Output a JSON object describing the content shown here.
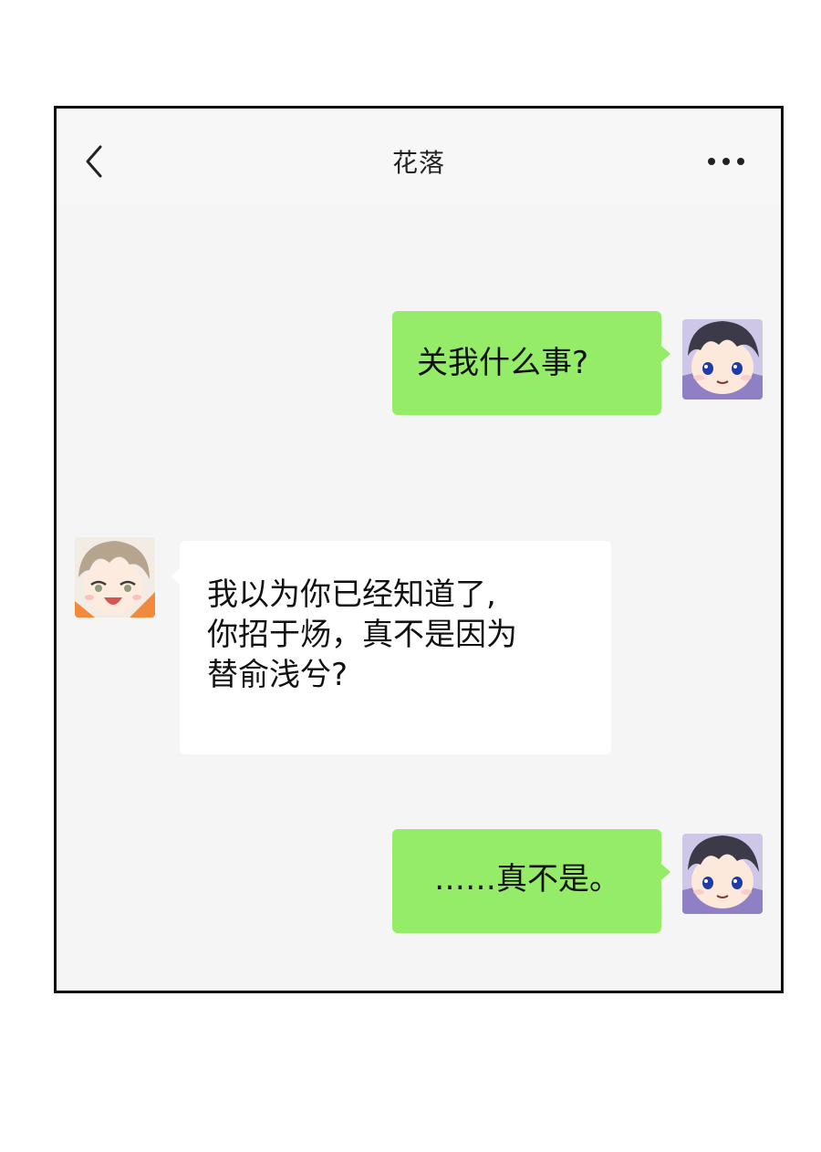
{
  "header": {
    "title": "花落",
    "back_icon": "chevron-left-icon",
    "more_icon": "more-dots-icon"
  },
  "messages": [
    {
      "sender": "me",
      "text": "关我什么事?"
    },
    {
      "sender": "other",
      "lines": [
        "我以为你已经知道了,",
        "你招于炀，真不是因为",
        "替俞浅兮?"
      ]
    },
    {
      "sender": "me",
      "text": "……真不是。"
    }
  ],
  "colors": {
    "me_bubble": "#95ec69",
    "other_bubble": "#ffffff",
    "chat_background": "#f5f5f5",
    "frame_border": "#111111"
  }
}
